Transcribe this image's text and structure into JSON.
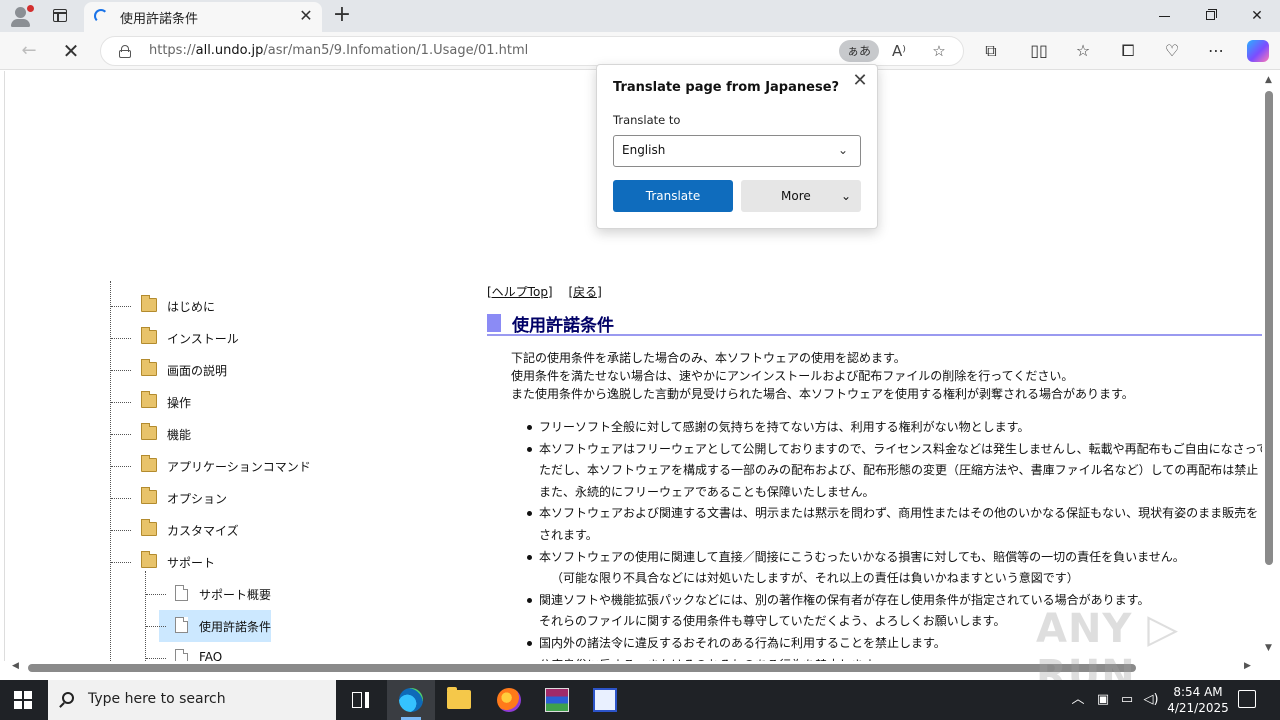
{
  "browser": {
    "tab_title": "使用許諾条件",
    "tab_close": "✕",
    "new_tab": "+",
    "window_controls": {
      "minimize": "minimize",
      "maximize": "restore",
      "close": "✕"
    },
    "url_prefix": "https://",
    "url_host": "all.undo.jp",
    "url_path": "/asr/man5/9.Infomation/1.Usage/01.html",
    "translate_pill": "ぁあ",
    "toolbar_icons": [
      "read-aloud-icon",
      "favorite-star-icon",
      "extensions-icon",
      "split-screen-icon",
      "favorites-icon",
      "collections-icon",
      "browser-essentials-icon",
      "more-icon",
      "copilot-icon"
    ]
  },
  "translate_popup": {
    "title": "Translate page from Japanese?",
    "label": "Translate to",
    "language": "English",
    "translate_button": "Translate",
    "more_button": "More"
  },
  "tree": {
    "items": [
      {
        "label": "はじめに",
        "type": "folder"
      },
      {
        "label": "インストール",
        "type": "folder"
      },
      {
        "label": "画面の説明",
        "type": "folder"
      },
      {
        "label": "操作",
        "type": "folder"
      },
      {
        "label": "機能",
        "type": "folder"
      },
      {
        "label": "アプリケーションコマンド",
        "type": "folder"
      },
      {
        "label": "オプション",
        "type": "folder"
      },
      {
        "label": "カスタマイズ",
        "type": "folder"
      },
      {
        "label": "サポート",
        "type": "folder"
      }
    ],
    "children": [
      {
        "label": "サポート概要",
        "type": "page"
      },
      {
        "label": "使用許諾条件",
        "type": "page",
        "selected": true
      },
      {
        "label": "FAQ",
        "type": "page"
      }
    ]
  },
  "content": {
    "links": [
      "[ヘルプTop]",
      "[戻る]"
    ],
    "heading": "使用許諾条件",
    "intro": [
      "下記の使用条件を承諾した場合のみ、本ソフトウェアの使用を認めます。",
      "使用条件を満たせない場合は、速やかにアンインストールおよび配布ファイルの削除を行ってください。",
      "また使用条件から逸脱した言動が見受けられた場合、本ソフトウェアを使用する権利が剥奪される場合があります。"
    ],
    "bullets": [
      {
        "lines": [
          "フリーソフト全般に対して感謝の気持ちを持てない方は、利用する権利がない物とします。"
        ]
      },
      {
        "lines": [
          "本ソフトウェアはフリーウェアとして公開しておりますので、ライセンス料金などは発生しませんし、転載や再配布もご自由になさって",
          "ただし、本ソフトウェアを構成する一部のみの配布および、配布形態の変更（圧縮方法や、書庫ファイル名など）しての再配布は禁止",
          "また、永続的にフリーウェアであることも保障いたしません。"
        ]
      },
      {
        "lines": [
          "本ソフトウェアおよび関連する文書は、明示または黙示を問わず、商用性またはその他のいかなる保証もない、現状有姿のまま販売を",
          "されます。"
        ]
      },
      {
        "lines": [
          "本ソフトウェアの使用に関連して直接／間接にこうむったいかなる損害に対しても、賠償等の一切の責任を負いません。"
        ],
        "indent": "（可能な限り不具合などには対処いたしますが、それ以上の責任は負いかねますという意図です）"
      },
      {
        "lines": [
          "関連ソフトや機能拡張パックなどには、別の著作権の保有者が存在し使用条件が指定されている場合があります。",
          "それらのファイルに関する使用条件も尊守していただくよう、よろしくお願いします。"
        ]
      },
      {
        "lines": [
          "国内外の諸法令に違反するおそれのある行為に利用することを禁止します。",
          "公序良俗に反する、またはそのおそれのある行為を禁止します。"
        ]
      }
    ]
  },
  "watermark": "ANY RUN",
  "taskbar": {
    "search_placeholder": "Type here to search",
    "apps": [
      "task-view-icon",
      "edge-icon",
      "file-explorer-icon",
      "firefox-icon",
      "winrar-icon",
      "tool-icon"
    ],
    "time": "8:54 AM",
    "date": "4/21/2025"
  }
}
